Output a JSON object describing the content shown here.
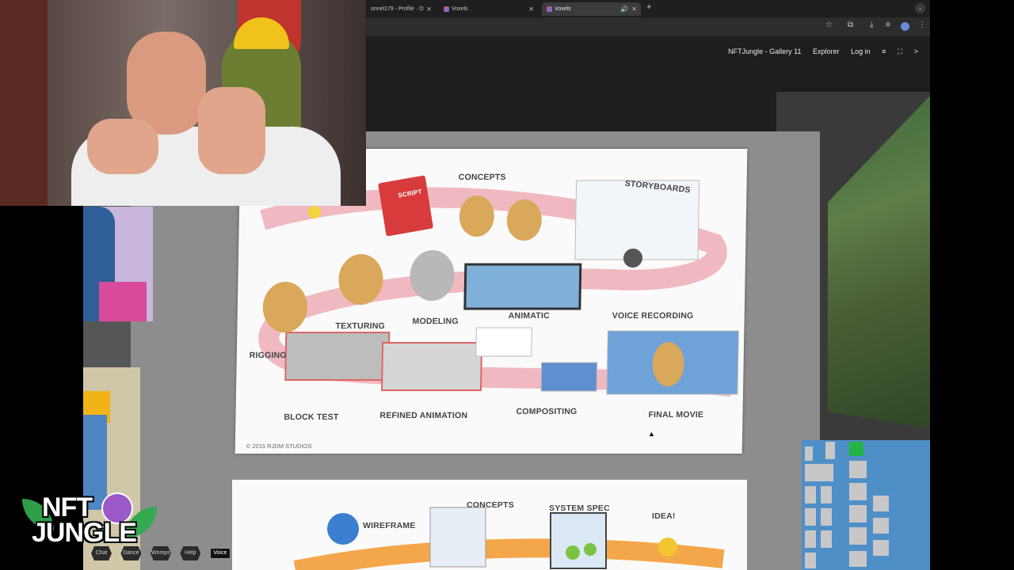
{
  "browser": {
    "tabs": [
      {
        "label": "onnel179 - Profile · O"
      },
      {
        "label": "Voxels"
      },
      {
        "label": "Voxels",
        "active": true
      }
    ],
    "new_tab_icon": "plus-icon"
  },
  "site_nav": {
    "title": "NFTJungle - Gallery 11",
    "explorer": "Explorer",
    "login": "Log in",
    "menu_icon": "hamburger-icon",
    "fullscreen_icon": "expand-icon",
    "next_icon": "chevron-right-icon"
  },
  "poster": {
    "labels": {
      "concepts": "CONCEPTS",
      "storyboards": "STORYBOARDS",
      "texturing": "TEXTURING",
      "modeling": "MODELING",
      "animatic": "ANIMATIC",
      "voice_recording": "VOICE RECORDING",
      "rigging": "RIGGING",
      "block_test": "BLOCK TEST",
      "refined_animation": "REFINED ANIMATION",
      "compositing": "COMPOSITING",
      "final_movie": "FINAL MOVIE",
      "script": "SCRIPT"
    },
    "copyright": "© 2015 RJDM STUDIOS"
  },
  "poster2": {
    "labels": {
      "wireframe": "WIREFRAME",
      "concepts": "CONCEPTS",
      "system_spec": "SYSTEM SPEC",
      "idea": "IDEA!"
    }
  },
  "logo": {
    "line1": "NFT",
    "line2": "JUNGLE"
  },
  "bottom_menu": {
    "items": [
      "Chat",
      "Dance",
      "Womps",
      "Help"
    ],
    "voice": "Voice"
  }
}
